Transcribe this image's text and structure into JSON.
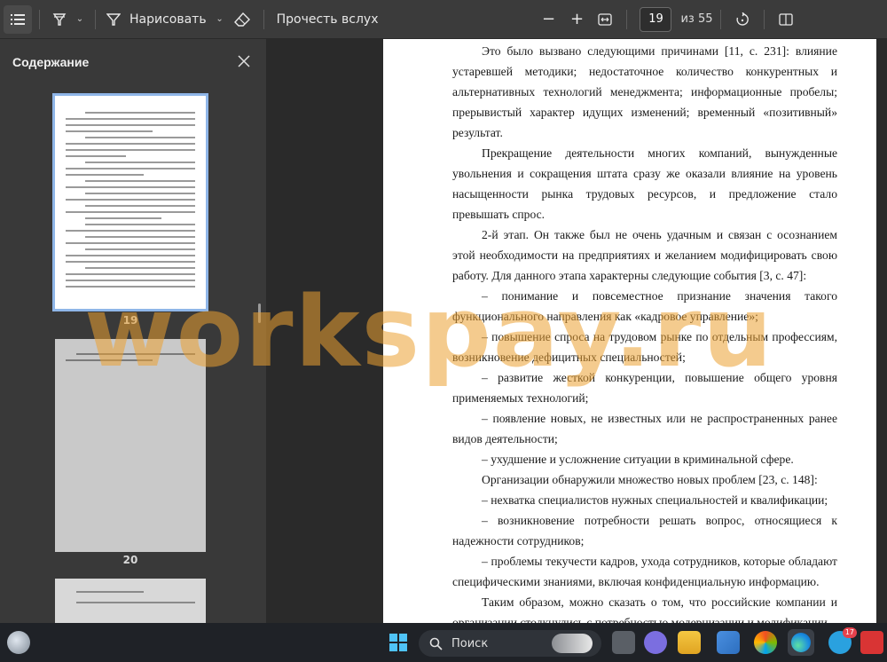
{
  "toolbar": {
    "draw_label": "Нарисовать",
    "read_aloud_label": "Прочесть вслух",
    "page_number": "19",
    "page_total": "из 55",
    "zoom_out": "−",
    "zoom_in": "+"
  },
  "sidebar": {
    "title": "Содержание",
    "thumbnails": [
      {
        "page": "19",
        "selected": true
      },
      {
        "page": "20",
        "selected": false
      }
    ]
  },
  "document": {
    "paragraphs": [
      {
        "text": "Это было вызвано следующими причинами [11, с. 231]: влияние устаревшей методики; недостаточное количество конкурентных и альтернативных технологий менеджмента; информационные пробелы; прерывистый характер идущих изменений; временный «позитивный» результат.",
        "indent": true
      },
      {
        "text": "Прекращение деятельности многих компаний, вынужденные увольнения и сокращения штата сразу же оказали влияние на уровень насыщенности рынка трудовых ресурсов, и предложение стало превышать спрос.",
        "indent": true
      },
      {
        "text": "2-й этап. Он также был не очень удачным и связан с осознанием этой необходимости на предприятиях и желанием модифицировать свою работу. Для данного этапа характерны следующие события [3, с. 47]:",
        "indent": true
      },
      {
        "text": "– понимание и повсеместное признание значения такого функционального направления как «кадровое управление»;",
        "indent": true
      },
      {
        "text": "– повышение спроса на трудовом рынке по отдельным профессиям, возникновение дефицитных специальностей;",
        "indent": true
      },
      {
        "text": "– развитие жесткой конкуренции, повышение общего уровня применяемых технологий;",
        "indent": true
      },
      {
        "text": "– появление новых, не известных или не распространенных ранее видов деятельности;",
        "indent": true
      },
      {
        "text": "– ухудшение и усложнение ситуации в криминальной сфере.",
        "indent": true
      },
      {
        "text": "Организации обнаружили множество новых проблем [23, с. 148]:",
        "indent": true
      },
      {
        "text": "– нехватка специалистов нужных специальностей и квалификации;",
        "indent": true
      },
      {
        "text": "– возникновение потребности решать вопрос, относящиеся к надежности сотрудников;",
        "indent": true
      },
      {
        "text": "– проблемы текучести кадров, ухода сотрудников, которые обладают специфическими знаниями, включая конфиденциальную информацию.",
        "indent": true
      },
      {
        "text": "Таким образом, можно сказать о том, что российские компании и организации столкнулись с потребностью модернизации и модификации",
        "indent": true
      }
    ]
  },
  "watermark": "workspay.ru",
  "taskbar": {
    "search_label": "Поиск",
    "telegram_badge": "17"
  },
  "colors": {
    "toolbar_bg": "#3b3b3b",
    "sidebar_bg": "#393939",
    "canvas_bg": "#2a2a2a",
    "selected_outline": "#8fb6e8",
    "watermark": "#eba032",
    "taskbar_bg": "#1f2227"
  },
  "icons": [
    "list-icon",
    "highlighter-icon",
    "draw-icon",
    "eraser-icon",
    "fit-width-icon",
    "rotate-icon",
    "two-page-icon",
    "close-icon",
    "search-icon",
    "windows-start-icon",
    "edge-icon",
    "telegram-icon"
  ]
}
